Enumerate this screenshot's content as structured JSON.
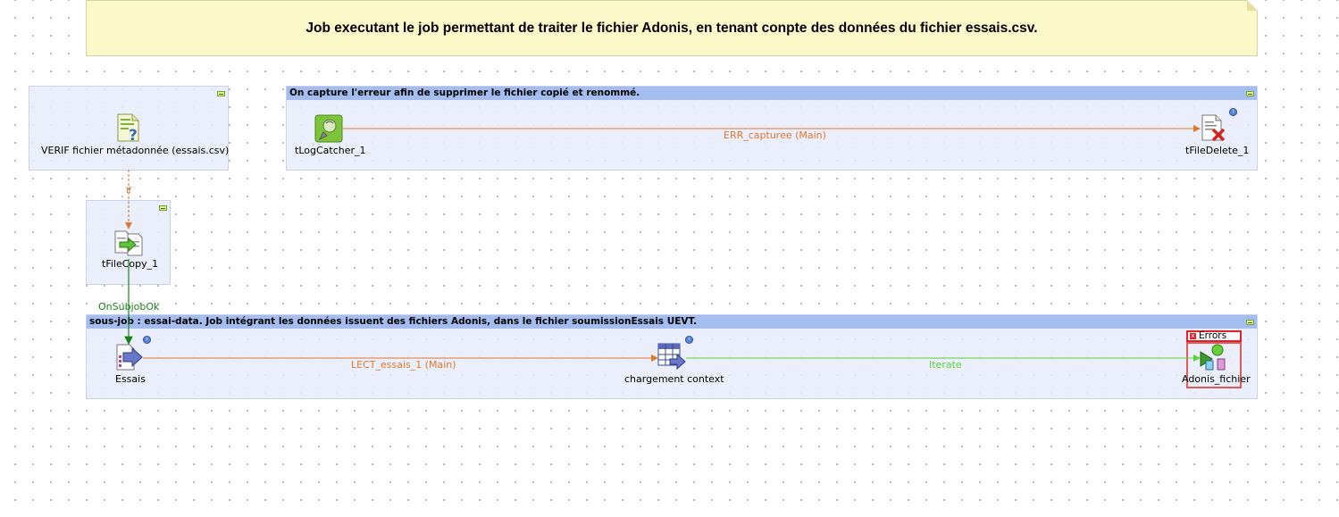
{
  "note": {
    "text": "Job executant le job permettant de traiter le fichier Adonis, en tenant conpte des données du fichier essais.csv."
  },
  "subjobs": {
    "verif": {
      "component_label": "VERIF fichier métadonnée (essais.csv)"
    },
    "capture": {
      "title": "On capture l'erreur afin de supprimer le fichier copié et renommé.",
      "source_label": "tLogCatcher_1",
      "target_label": "tFileDelete_1",
      "connection_label": "ERR_capturee (Main)"
    },
    "copy": {
      "component_label": "tFileCopy_1"
    },
    "main": {
      "title": "sous-job : essai-data. Job intégrant les données issuent des fichiers Adonis, dans le fichier soumissionEssais UEVT.",
      "essais_label": "Essais",
      "chargement_label": "chargement context",
      "adonis_label": "Adonis_fichier",
      "flow_label": "LECT_essais_1 (Main)",
      "iterate_label": "Iterate",
      "error_label": "Errors"
    }
  },
  "triggers": {
    "if_label": "If",
    "onsubjobok_label": "OnSubjobOk"
  },
  "colors": {
    "main_flow": "#e0782c",
    "iterate": "#5cd23a",
    "subjob_ok": "#19821b",
    "header": "#a4bdf0",
    "note_bg": "#fbf8c9",
    "error": "#e0202a"
  }
}
